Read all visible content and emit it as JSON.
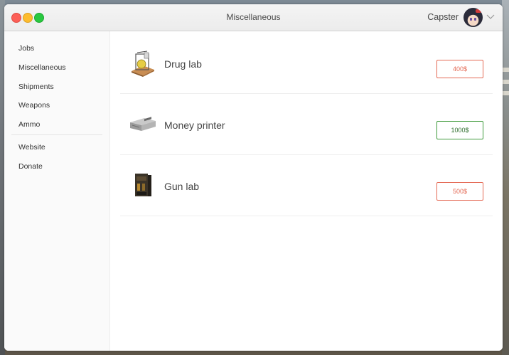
{
  "window": {
    "title": "Miscellaneous"
  },
  "user": {
    "name": "Capster",
    "avatar_icon": "avatar-anime-girl",
    "menu_icon": "chevron-down-icon"
  },
  "sidebar": {
    "items": [
      {
        "label": "Jobs"
      },
      {
        "label": "Miscellaneous"
      },
      {
        "label": "Shipments"
      },
      {
        "label": "Weapons"
      },
      {
        "label": "Ammo"
      }
    ],
    "links": [
      {
        "label": "Website"
      },
      {
        "label": "Donate"
      }
    ]
  },
  "items": [
    {
      "name": "Drug lab",
      "price": "400$",
      "affordable": false,
      "icon": "drug-lab-icon",
      "status_color": "#e46a55"
    },
    {
      "name": "Money printer",
      "price": "1000$",
      "affordable": true,
      "icon": "money-printer-icon",
      "status_color": "#3f9a3c"
    },
    {
      "name": "Gun lab",
      "price": "500$",
      "affordable": false,
      "icon": "gun-lab-icon",
      "status_color": "#e46a55"
    }
  ],
  "colors": {
    "close": "#fc5f57",
    "minimize": "#fdbc2e",
    "maximize": "#29c840",
    "unaffordable": "#e46a55",
    "affordable": "#3f9a3c"
  }
}
